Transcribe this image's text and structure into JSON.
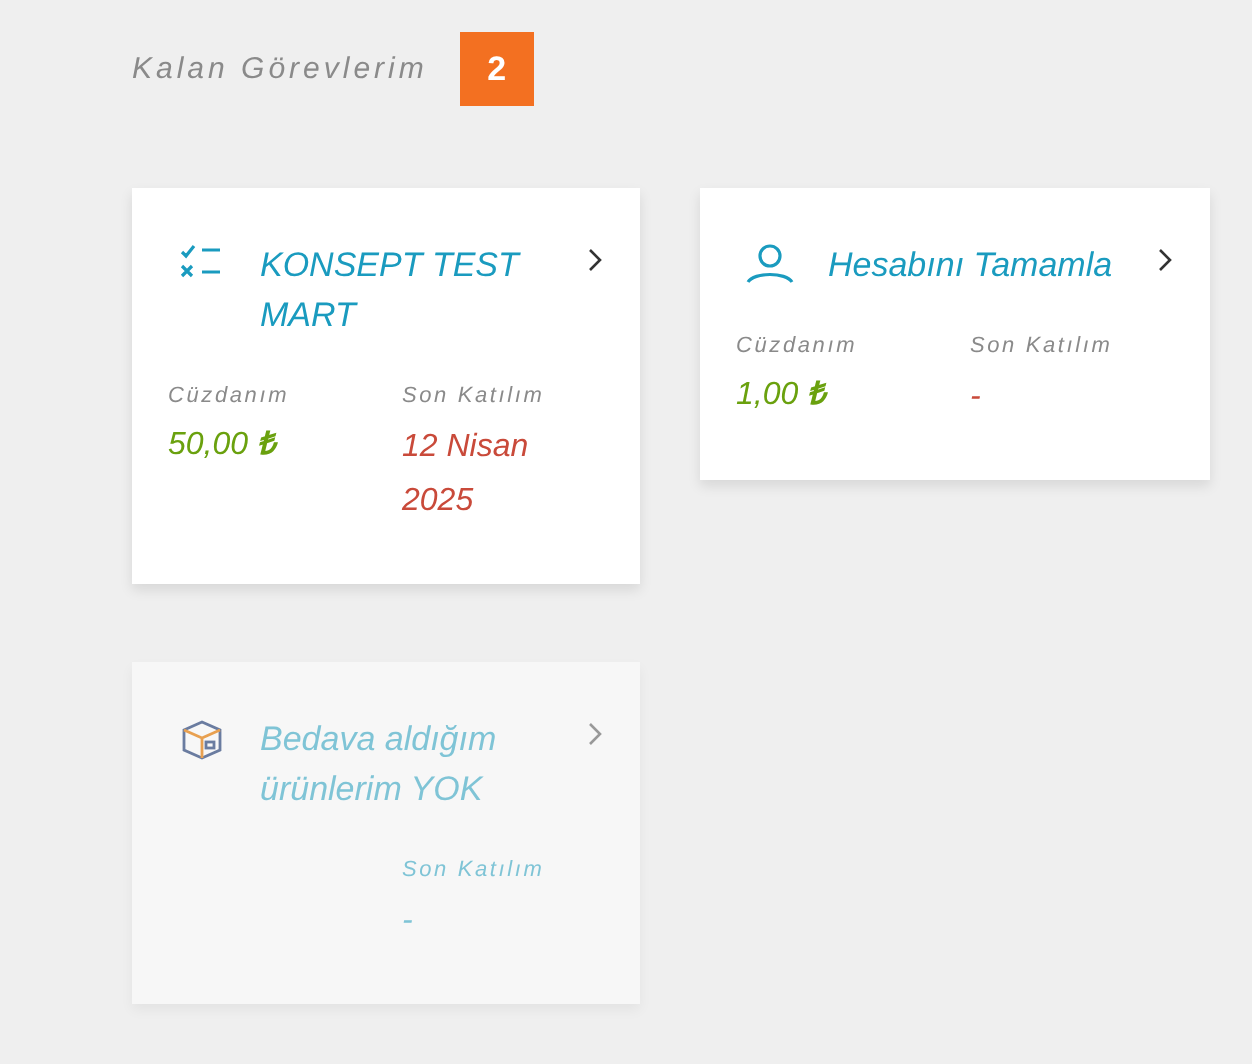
{
  "header": {
    "title": "Kalan Görevlerim",
    "count": "2"
  },
  "cards": [
    {
      "kind": "checklist",
      "title": "KONSEPT TEST MART",
      "disabled": false,
      "wallet": {
        "label": "Cüzdanım",
        "value": "50,00",
        "currency": "₺"
      },
      "deadline": {
        "label": "Son Katılım",
        "value": "12 Nisan 2025"
      }
    },
    {
      "kind": "profile",
      "title": "Hesabını Tamamla",
      "disabled": false,
      "wallet": {
        "label": "Cüzdanım",
        "value": "1,00",
        "currency": "₺"
      },
      "deadline": {
        "label": "Son Katılım",
        "value": "-"
      }
    },
    {
      "kind": "package",
      "title": "Bedava aldığım ürünlerim YOK",
      "disabled": true,
      "deadline": {
        "label": "Son Katılım",
        "value": "-"
      }
    }
  ]
}
